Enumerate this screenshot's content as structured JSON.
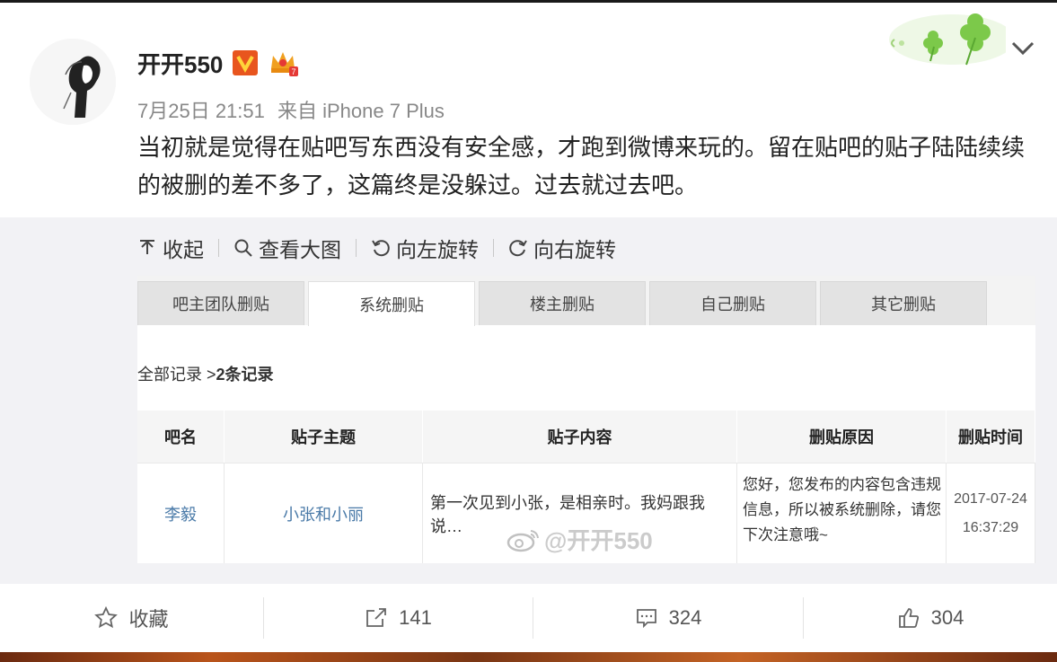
{
  "post": {
    "author": "开开550",
    "date": "7月25日 21:51",
    "source": "来自 iPhone 7 Plus",
    "text": "当初就是觉得在贴吧写东西没有安全感，才跑到微博来玩的。留在贴吧的贴子陆陆续续的被删的差不多了，这篇终是没躲过。过去就过去吧。"
  },
  "toolbar": {
    "collapse": "收起",
    "view_large": "查看大图",
    "rotate_left": "向左旋转",
    "rotate_right": "向右旋转"
  },
  "screenshot": {
    "tabs": [
      "吧主团队删贴",
      "系统删贴",
      "楼主删贴",
      "自己删贴",
      "其它删贴"
    ],
    "active_tab": "系统删贴",
    "records_prefix": "全部记录 >",
    "records_count": "2条记录",
    "columns": [
      "吧名",
      "贴子主题",
      "贴子内容",
      "删贴原因",
      "删贴时间"
    ],
    "row": {
      "forum": "李毅",
      "topic": "小张和小丽",
      "content": "第一次见到小张，是相亲时。我妈跟我说…",
      "reason": "您好，您发布的内容包含违规信息，所以被系统删除，请您下次注意哦~",
      "date": "2017-07-24",
      "time": "16:37:29"
    },
    "watermark": "@开开550"
  },
  "actions": {
    "favorite": "收藏",
    "share_count": "141",
    "comment_count": "324",
    "like_count": "304"
  },
  "colors": {
    "link": "#4a7aa8",
    "vip_badge": "#e8551e",
    "crown": "#f0a020",
    "clover": "#7cc94a"
  },
  "icons": [
    "vip-badge-icon",
    "crown-icon",
    "clover-decoration-icon",
    "chevron-down-icon",
    "upload-icon",
    "search-icon",
    "rotate-left-icon",
    "rotate-right-icon",
    "weibo-icon",
    "star-icon",
    "share-icon",
    "comment-icon",
    "thumbs-up-icon"
  ]
}
